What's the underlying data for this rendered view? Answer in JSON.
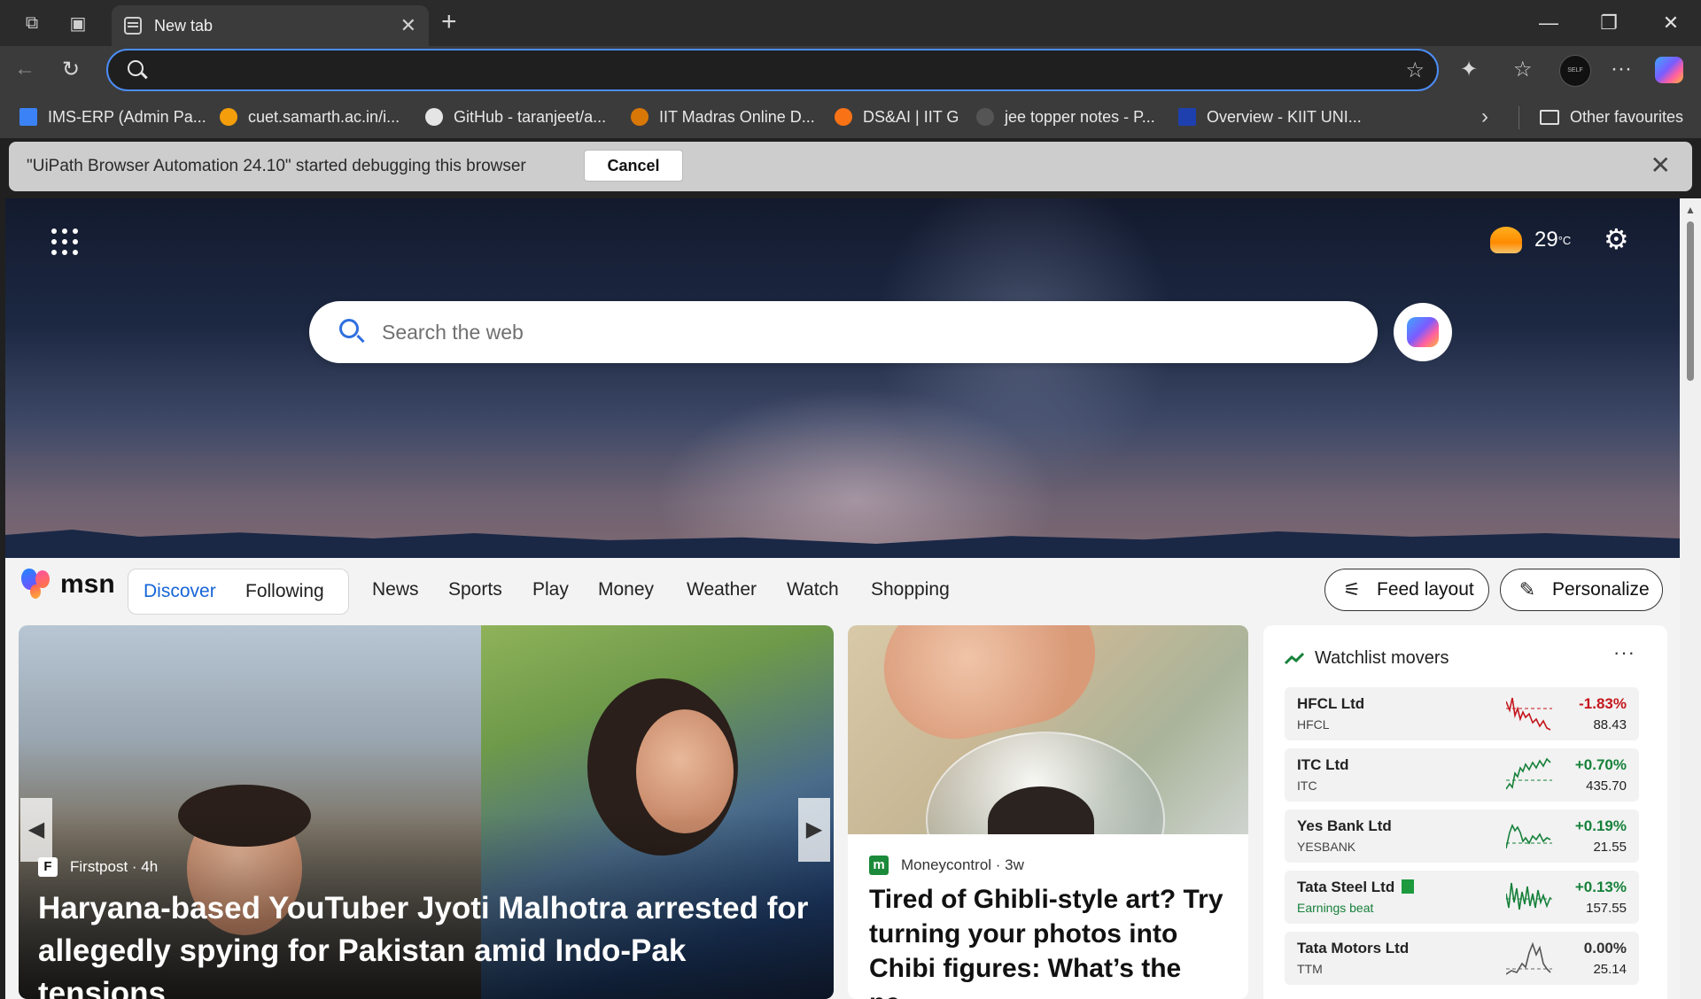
{
  "browser": {
    "tab": {
      "title": "New tab",
      "icon": "new-tab-page-icon"
    },
    "address_bar": {
      "value": "",
      "icons": [
        "search-icon",
        "star-icon"
      ]
    },
    "toolbar_icons": [
      "back-icon",
      "refresh-icon",
      "extensions-icon",
      "favorites-icon",
      "profile-avatar",
      "more-icon",
      "copilot-icon"
    ],
    "profile_avatar_text": "SELF",
    "bookmarks": [
      {
        "label": "IMS-ERP (Admin Pa...",
        "color": "#3b82f6"
      },
      {
        "label": "cuet.samarth.ac.in/i...",
        "color": "#f59e0b"
      },
      {
        "label": "GitHub - taranjeet/a...",
        "color": "#e5e5e5"
      },
      {
        "label": "IIT Madras Online D...",
        "color": "#d97706"
      },
      {
        "label": "DS&AI | IIT G",
        "color": "#f97316"
      },
      {
        "label": "jee topper notes - P...",
        "color": "#555555"
      },
      {
        "label": "Overview - KIIT UNI...",
        "color": "#1e40af"
      }
    ],
    "other_favourites": "Other favourites",
    "infobar": {
      "message": "\"UiPath Browser Automation 24.10\" started debugging this browser",
      "button": "Cancel"
    }
  },
  "ntp": {
    "weather": {
      "temp": "29",
      "unit": "°C"
    },
    "search_placeholder": "Search the web",
    "logo": "msn",
    "segments": [
      "Discover",
      "Following"
    ],
    "nav": [
      "News",
      "Sports",
      "Play",
      "Money",
      "Weather",
      "Watch",
      "Shopping"
    ],
    "feed_layout": "Feed layout",
    "personalize": "Personalize",
    "hero": {
      "source": "Firstpost",
      "age": "· 4h",
      "title": "Haryana-based YouTuber Jyoti Malhotra arrested for allegedly spying for Pakistan amid Indo-Pak tensions"
    },
    "story": {
      "source": "Moneycontrol",
      "age": "· 3w",
      "title": "Tired of Ghibli-style art? Try turning your photos into Chibi figures: What’s the ne..."
    },
    "watchlist": {
      "title": "Watchlist movers",
      "stocks": [
        {
          "name": "HFCL Ltd",
          "symbol": "HFCL",
          "change": "-1.83%",
          "price": "88.43",
          "trend": "down"
        },
        {
          "name": "ITC Ltd",
          "symbol": "ITC",
          "change": "+0.70%",
          "price": "435.70",
          "trend": "up"
        },
        {
          "name": "Yes Bank Ltd",
          "symbol": "YESBANK",
          "change": "+0.19%",
          "price": "21.55",
          "trend": "up"
        },
        {
          "name": "Tata Steel Ltd",
          "symbol": "Earnings beat",
          "change": "+0.13%",
          "price": "157.55",
          "trend": "up"
        },
        {
          "name": "Tata Motors Ltd",
          "symbol": "TTM",
          "change": "0.00%",
          "price": "25.14",
          "trend": "flat"
        }
      ]
    }
  }
}
